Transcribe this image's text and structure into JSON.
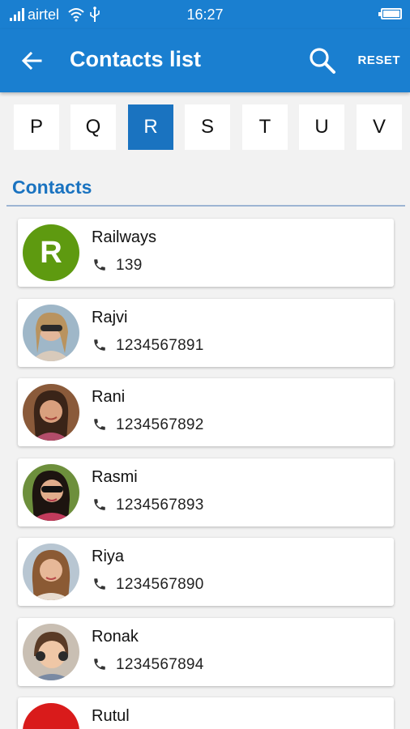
{
  "status_bar": {
    "carrier": "airtel",
    "time": "16:27"
  },
  "toolbar": {
    "title": "Contacts list",
    "reset_label": "RESET"
  },
  "letters": [
    "P",
    "Q",
    "R",
    "S",
    "T",
    "U",
    "V"
  ],
  "active_letter": "R",
  "section_title": "Contacts",
  "contacts": [
    {
      "name": "Railways",
      "number": "139",
      "initial": "R",
      "avatar_color": "#5e9a10"
    },
    {
      "name": "Rajvi",
      "number": "1234567891"
    },
    {
      "name": "Rani",
      "number": "1234567892"
    },
    {
      "name": "Rasmi",
      "number": "1234567893"
    },
    {
      "name": "Riya",
      "number": "1234567890"
    },
    {
      "name": "Ronak",
      "number": "1234567894"
    },
    {
      "name": "Rutul",
      "number": "",
      "avatar_color": "#d91b1b"
    }
  ],
  "colors": {
    "primary": "#1a7fd0",
    "accent": "#1a73c0",
    "background": "#f2f2f2"
  }
}
